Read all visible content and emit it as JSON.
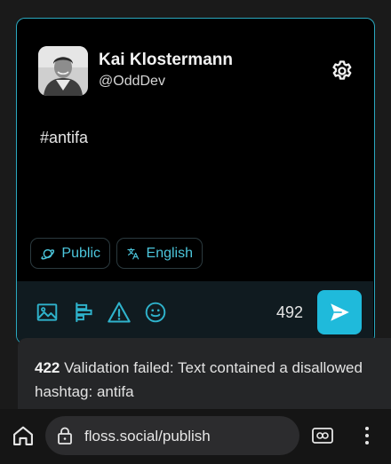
{
  "profile": {
    "display_name": "Kai Klostermann",
    "handle": "@OddDev"
  },
  "post": {
    "text": "#antifa"
  },
  "options": {
    "visibility": "Public",
    "language": "English"
  },
  "toolbar": {
    "tools": [
      "image-icon",
      "poll-icon",
      "content-warning-icon",
      "emoji-icon"
    ],
    "char_count": "492"
  },
  "toast": {
    "code": "422",
    "message": "Validation failed: Text contained a disallowed hashtag: antifa"
  },
  "browser": {
    "url": "floss.social/publish"
  },
  "colors": {
    "accent": "#2aa8bf",
    "send_button": "#1fbadb",
    "chip_text": "#4cc6dc"
  }
}
